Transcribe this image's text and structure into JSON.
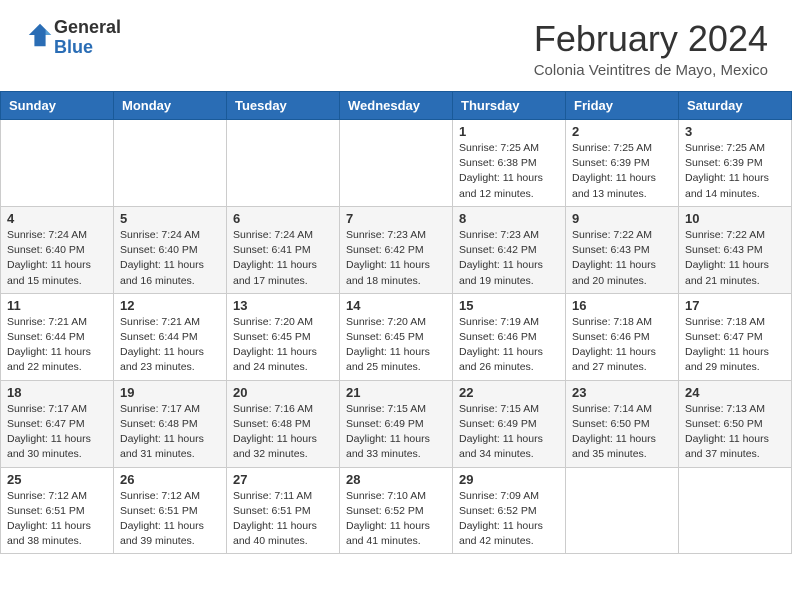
{
  "header": {
    "logo_general": "General",
    "logo_blue": "Blue",
    "title": "February 2024",
    "subtitle": "Colonia Veintitres de Mayo, Mexico"
  },
  "days_of_week": [
    "Sunday",
    "Monday",
    "Tuesday",
    "Wednesday",
    "Thursday",
    "Friday",
    "Saturday"
  ],
  "weeks": [
    [
      {
        "day": "",
        "info": ""
      },
      {
        "day": "",
        "info": ""
      },
      {
        "day": "",
        "info": ""
      },
      {
        "day": "",
        "info": ""
      },
      {
        "day": "1",
        "info": "Sunrise: 7:25 AM\nSunset: 6:38 PM\nDaylight: 11 hours\nand 12 minutes."
      },
      {
        "day": "2",
        "info": "Sunrise: 7:25 AM\nSunset: 6:39 PM\nDaylight: 11 hours\nand 13 minutes."
      },
      {
        "day": "3",
        "info": "Sunrise: 7:25 AM\nSunset: 6:39 PM\nDaylight: 11 hours\nand 14 minutes."
      }
    ],
    [
      {
        "day": "4",
        "info": "Sunrise: 7:24 AM\nSunset: 6:40 PM\nDaylight: 11 hours\nand 15 minutes."
      },
      {
        "day": "5",
        "info": "Sunrise: 7:24 AM\nSunset: 6:40 PM\nDaylight: 11 hours\nand 16 minutes."
      },
      {
        "day": "6",
        "info": "Sunrise: 7:24 AM\nSunset: 6:41 PM\nDaylight: 11 hours\nand 17 minutes."
      },
      {
        "day": "7",
        "info": "Sunrise: 7:23 AM\nSunset: 6:42 PM\nDaylight: 11 hours\nand 18 minutes."
      },
      {
        "day": "8",
        "info": "Sunrise: 7:23 AM\nSunset: 6:42 PM\nDaylight: 11 hours\nand 19 minutes."
      },
      {
        "day": "9",
        "info": "Sunrise: 7:22 AM\nSunset: 6:43 PM\nDaylight: 11 hours\nand 20 minutes."
      },
      {
        "day": "10",
        "info": "Sunrise: 7:22 AM\nSunset: 6:43 PM\nDaylight: 11 hours\nand 21 minutes."
      }
    ],
    [
      {
        "day": "11",
        "info": "Sunrise: 7:21 AM\nSunset: 6:44 PM\nDaylight: 11 hours\nand 22 minutes."
      },
      {
        "day": "12",
        "info": "Sunrise: 7:21 AM\nSunset: 6:44 PM\nDaylight: 11 hours\nand 23 minutes."
      },
      {
        "day": "13",
        "info": "Sunrise: 7:20 AM\nSunset: 6:45 PM\nDaylight: 11 hours\nand 24 minutes."
      },
      {
        "day": "14",
        "info": "Sunrise: 7:20 AM\nSunset: 6:45 PM\nDaylight: 11 hours\nand 25 minutes."
      },
      {
        "day": "15",
        "info": "Sunrise: 7:19 AM\nSunset: 6:46 PM\nDaylight: 11 hours\nand 26 minutes."
      },
      {
        "day": "16",
        "info": "Sunrise: 7:18 AM\nSunset: 6:46 PM\nDaylight: 11 hours\nand 27 minutes."
      },
      {
        "day": "17",
        "info": "Sunrise: 7:18 AM\nSunset: 6:47 PM\nDaylight: 11 hours\nand 29 minutes."
      }
    ],
    [
      {
        "day": "18",
        "info": "Sunrise: 7:17 AM\nSunset: 6:47 PM\nDaylight: 11 hours\nand 30 minutes."
      },
      {
        "day": "19",
        "info": "Sunrise: 7:17 AM\nSunset: 6:48 PM\nDaylight: 11 hours\nand 31 minutes."
      },
      {
        "day": "20",
        "info": "Sunrise: 7:16 AM\nSunset: 6:48 PM\nDaylight: 11 hours\nand 32 minutes."
      },
      {
        "day": "21",
        "info": "Sunrise: 7:15 AM\nSunset: 6:49 PM\nDaylight: 11 hours\nand 33 minutes."
      },
      {
        "day": "22",
        "info": "Sunrise: 7:15 AM\nSunset: 6:49 PM\nDaylight: 11 hours\nand 34 minutes."
      },
      {
        "day": "23",
        "info": "Sunrise: 7:14 AM\nSunset: 6:50 PM\nDaylight: 11 hours\nand 35 minutes."
      },
      {
        "day": "24",
        "info": "Sunrise: 7:13 AM\nSunset: 6:50 PM\nDaylight: 11 hours\nand 37 minutes."
      }
    ],
    [
      {
        "day": "25",
        "info": "Sunrise: 7:12 AM\nSunset: 6:51 PM\nDaylight: 11 hours\nand 38 minutes."
      },
      {
        "day": "26",
        "info": "Sunrise: 7:12 AM\nSunset: 6:51 PM\nDaylight: 11 hours\nand 39 minutes."
      },
      {
        "day": "27",
        "info": "Sunrise: 7:11 AM\nSunset: 6:51 PM\nDaylight: 11 hours\nand 40 minutes."
      },
      {
        "day": "28",
        "info": "Sunrise: 7:10 AM\nSunset: 6:52 PM\nDaylight: 11 hours\nand 41 minutes."
      },
      {
        "day": "29",
        "info": "Sunrise: 7:09 AM\nSunset: 6:52 PM\nDaylight: 11 hours\nand 42 minutes."
      },
      {
        "day": "",
        "info": ""
      },
      {
        "day": "",
        "info": ""
      }
    ]
  ]
}
